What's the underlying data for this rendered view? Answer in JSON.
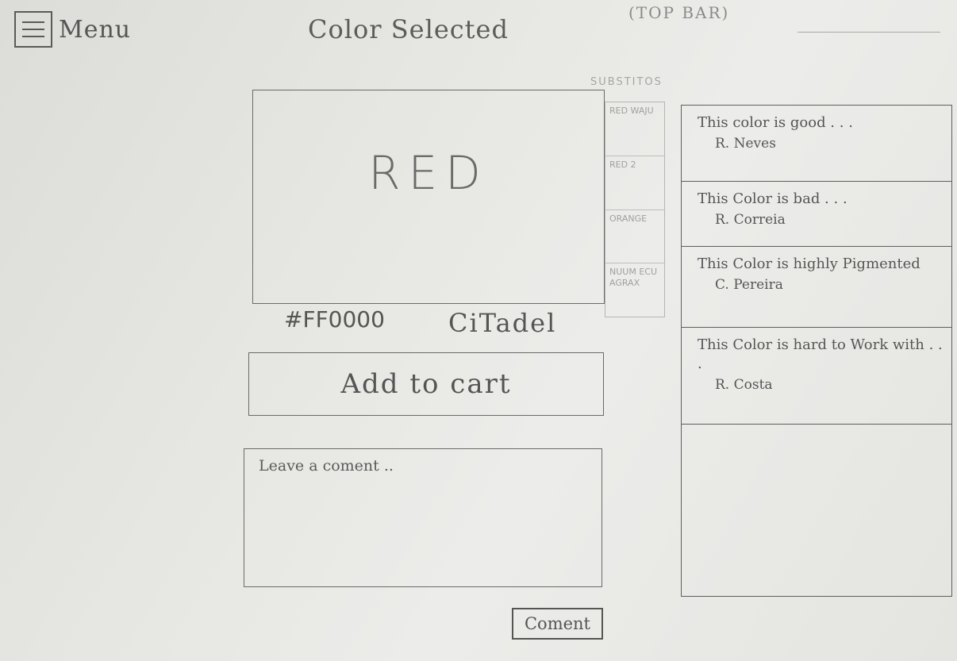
{
  "topbar": {
    "menu_label": "Menu",
    "title": "Color Selected",
    "note": "(TOP BAR)"
  },
  "swatch": {
    "name": "RED",
    "hex": "#FF0000",
    "brand": "CiTadel"
  },
  "substitutes": {
    "title": "SUBSTITOS",
    "items": [
      {
        "label": "RED WAJU"
      },
      {
        "label": "RED 2"
      },
      {
        "label": "ORANGE"
      },
      {
        "label": "NUUM ECU AGRAX"
      }
    ]
  },
  "cart": {
    "button_label": "Add to cart"
  },
  "comment_form": {
    "placeholder": "Leave a coment ..",
    "submit_label": "Coment"
  },
  "comments": [
    {
      "text": "This color is good . . .",
      "author": "R. Neves"
    },
    {
      "text": "This Color is bad . . .",
      "author": "R. Correia"
    },
    {
      "text": "This Color is highly Pigmented",
      "author": "C. Pereira"
    },
    {
      "text": "This Color is hard to Work with . . .",
      "author": "R. Costa"
    }
  ]
}
